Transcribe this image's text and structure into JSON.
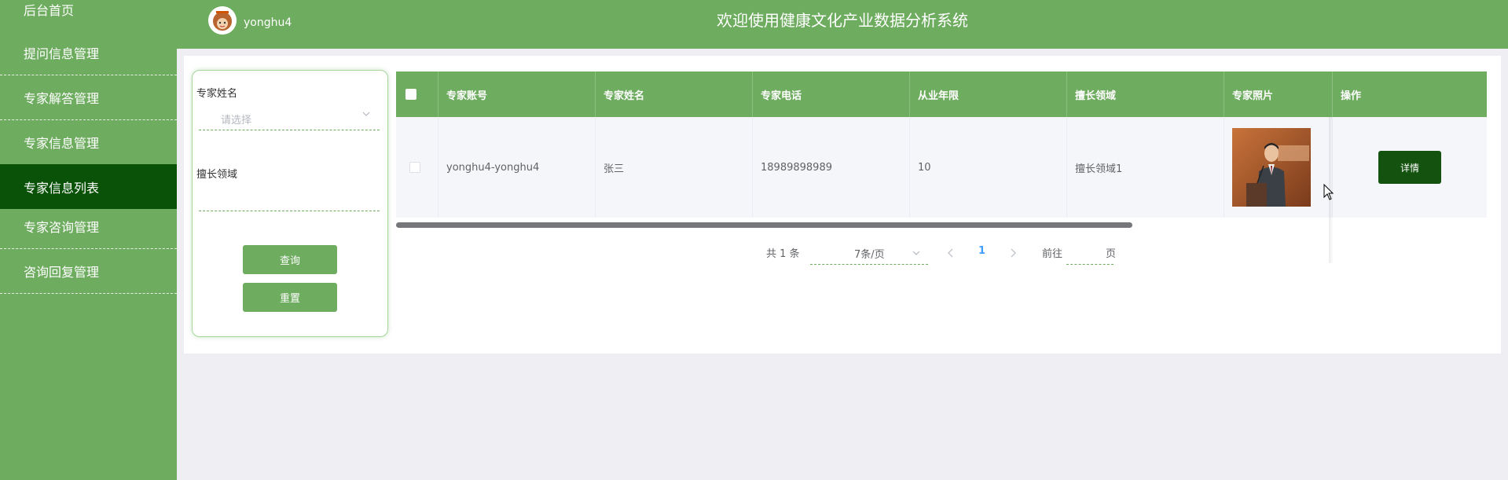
{
  "sidebar": {
    "items": [
      {
        "label": "后台首页"
      },
      {
        "label": "提问信息管理"
      },
      {
        "label": "专家解答管理"
      },
      {
        "label": "专家信息管理"
      },
      {
        "label": "专家信息列表"
      },
      {
        "label": "专家咨询管理"
      },
      {
        "label": "咨询回复管理"
      }
    ],
    "active": "专家信息列表"
  },
  "header": {
    "username": "yonghu4",
    "title": "欢迎使用健康文化产业数据分析系统"
  },
  "search": {
    "name_label": "专家姓名",
    "name_placeholder": "请选择",
    "field_label": "擅长领域",
    "query_button": "查询",
    "reset_button": "重置"
  },
  "table": {
    "columns": [
      "专家账号",
      "专家姓名",
      "专家电话",
      "从业年限",
      "擅长领域",
      "专家照片",
      "操作"
    ],
    "rows": [
      {
        "account": "yonghu4-yonghu4",
        "name": "张三",
        "phone": "18989898989",
        "years": "10",
        "field": "擅长领域1",
        "action": "详情"
      }
    ]
  },
  "pagination": {
    "total_text": "共 1 条",
    "page_size": "7条/页",
    "current_page": "1",
    "goto_prefix": "前往",
    "goto_suffix": "页"
  },
  "colors": {
    "primary": "#6eac5f",
    "sidebar_active": "#0a5207",
    "detail_button": "#14520f",
    "page_active": "#409eff"
  }
}
